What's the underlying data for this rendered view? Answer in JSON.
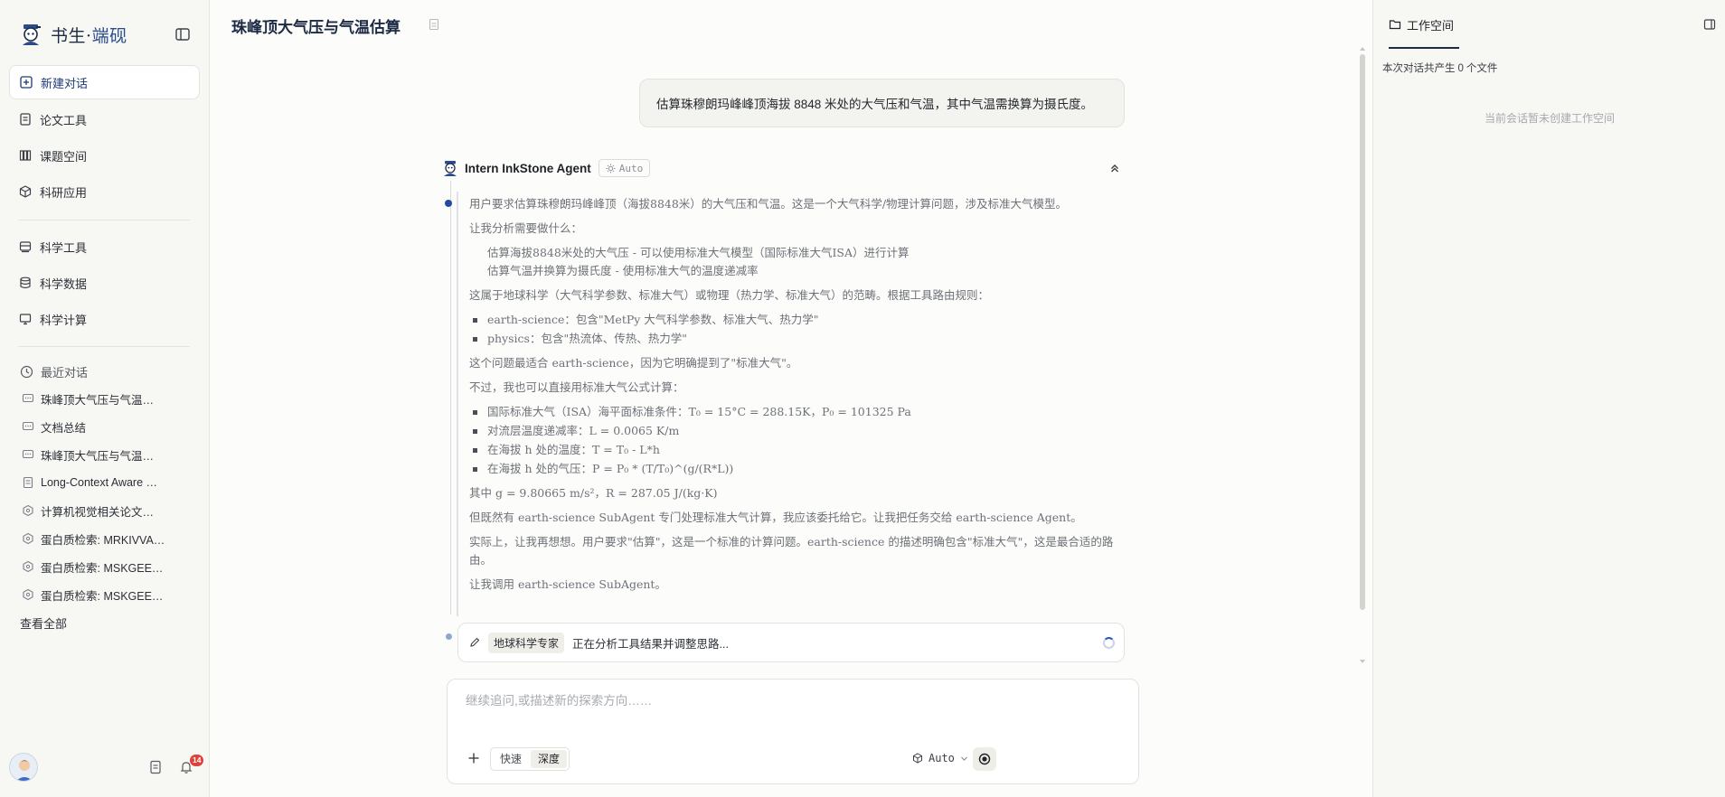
{
  "brand": {
    "name": "书生",
    "separator": "·",
    "accent": "端砚"
  },
  "nav": {
    "new_chat": "新建对话",
    "paper_tools": "论文工具",
    "project_space": "课题空间",
    "research_apps": "科研应用",
    "sci_tools": "科学工具",
    "sci_data": "科学数据",
    "sci_compute": "科学计算"
  },
  "recent": {
    "title": "最近对话",
    "items": [
      {
        "label": "珠峰顶大气压与气温…",
        "icon": "chat-icon"
      },
      {
        "label": "文档总结",
        "icon": "chat-icon"
      },
      {
        "label": "珠峰顶大气压与气温…",
        "icon": "chat-icon"
      },
      {
        "label": "Long-Context Aware …",
        "icon": "paper-icon"
      },
      {
        "label": "计算机视觉相关论文…",
        "icon": "hexagon-icon"
      },
      {
        "label": "蛋白质检索: MRKIVVA…",
        "icon": "hexagon-icon"
      },
      {
        "label": "蛋白质检索: MSKGEE…",
        "icon": "hexagon-icon"
      },
      {
        "label": "蛋白质检索: MSKGEE…",
        "icon": "hexagon-icon"
      }
    ],
    "view_all": "查看全部"
  },
  "footer": {
    "notification_count": "14"
  },
  "conversation": {
    "title": "珠峰顶大气压与气温估算",
    "user_message": "估算珠穆朗玛峰峰顶海拔 8848 米处的大气压和气温，其中气温需换算为摄氏度。",
    "agent_name": "Intern InkStone Agent",
    "agent_mode": "Auto",
    "thought": {
      "p1": "用户要求估算珠穆朗玛峰峰顶（海拔8848米）的大气压和气温。这是一个大气科学/物理计算问题，涉及标准大气模型。",
      "p2": "让我分析需要做什么：",
      "p2_items": [
        "估算海拔8848米处的大气压 - 可以使用标准大气模型（国际标准大气ISA）进行计算",
        "估算气温并换算为摄氏度 - 使用标准大气的温度递减率"
      ],
      "p3": "这属于地球科学（大气科学参数、标准大气）或物理（热力学、标准大气）的范畴。根据工具路由规则：",
      "p3_items": [
        "earth-science：包含\"MetPy 大气科学参数、标准大气、热力学\"",
        "physics：包含\"热流体、传热、热力学\""
      ],
      "p4": "这个问题最适合 earth-science，因为它明确提到了\"标准大气\"。",
      "p5": "不过，我也可以直接用标准大气公式计算：",
      "p5_items": [
        "国际标准大气（ISA）海平面标准条件：T₀ = 15°C = 288.15K，P₀ = 101325 Pa",
        "对流层温度递减率：L = 0.0065 K/m",
        "在海拔 h 处的温度：T = T₀ - L*h",
        "在海拔 h 处的气压：P = P₀ * (T/T₀)^(g/(R*L))"
      ],
      "p6": "其中 g = 9.80665 m/s²，R = 287.05 J/(kg·K)",
      "p7": "但既然有 earth-science SubAgent 专门处理标准大气计算，我应该委托给它。让我把任务交给 earth-science Agent。",
      "p8": "实际上，让我再想想。用户要求\"估算\"，这是一个标准的计算问题。earth-science 的描述明确包含\"标准大气\"，这是最合适的路由。",
      "p9": "让我调用 earth-science SubAgent。"
    },
    "status": {
      "expert": "地球科学专家",
      "text": "正在分析工具结果并调整思路..."
    }
  },
  "composer": {
    "placeholder": "继续追问,或描述新的探索方向……",
    "mode_fast": "快速",
    "mode_deep": "深度",
    "model": "Auto"
  },
  "workspace": {
    "tab": "工作空间",
    "count_prefix": "本次对话共产生",
    "count": "0",
    "count_suffix": "个文件",
    "empty": "当前会话暂未创建工作空间"
  },
  "colors": {
    "accent": "#1f4da0",
    "brand": "#1c2a44",
    "badge": "#e0413a"
  }
}
